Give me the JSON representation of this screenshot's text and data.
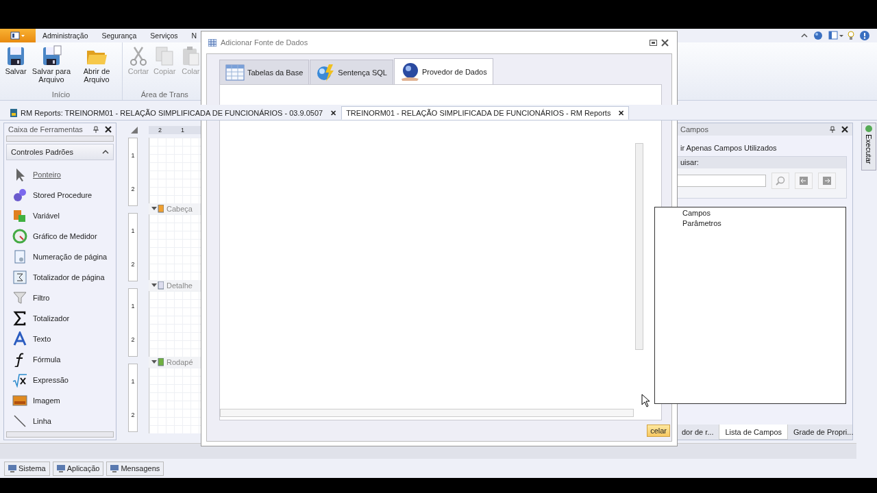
{
  "ribbon": {
    "tabs": [
      {
        "label": "Administração"
      },
      {
        "label": "Segurança"
      },
      {
        "label": "Serviços"
      },
      {
        "label": "N"
      }
    ],
    "groups": [
      {
        "label": "Início",
        "buttons": [
          {
            "label": "Salvar",
            "kind": "save",
            "disabled": false
          },
          {
            "label": "Salvar para Arquivo",
            "kind": "save-as",
            "disabled": false
          },
          {
            "label": "Abrir de Arquivo",
            "kind": "open",
            "disabled": false
          }
        ]
      },
      {
        "label": "Área de Trans",
        "buttons": [
          {
            "label": "Cortar",
            "kind": "cut",
            "disabled": true
          },
          {
            "label": "Copiar",
            "kind": "copy",
            "disabled": true
          },
          {
            "label": "Colar",
            "kind": "paste",
            "disabled": true
          }
        ]
      }
    ]
  },
  "doc_tabs": [
    {
      "label": "RM Reports: TREINORM01 - RELAÇÃO SIMPLIFICADA DE FUNCIONÁRIOS - 03.9.0507",
      "close": "✕",
      "selected": false
    },
    {
      "label": "TREINORM01 - RELAÇÃO SIMPLIFICADA DE FUNCIONÁRIOS - RM Reports",
      "close": "✕",
      "selected": true
    }
  ],
  "toolbox": {
    "title": "Caixa de Ferramentas",
    "section": "Controles Padrões",
    "expanded": true,
    "items": [
      {
        "label": "Ponteiro",
        "kind": "pointer",
        "selected": true
      },
      {
        "label": "Stored Procedure",
        "kind": "procedure",
        "selected": false
      },
      {
        "label": "Variável",
        "kind": "variable",
        "selected": false
      },
      {
        "label": "Gráfico de Medidor",
        "kind": "gauge",
        "selected": false
      },
      {
        "label": "Numeração de página",
        "kind": "page-number",
        "selected": false
      },
      {
        "label": "Totalizador de página",
        "kind": "page-total",
        "selected": false
      },
      {
        "label": "Filtro",
        "kind": "filter",
        "selected": false
      },
      {
        "label": "Totalizador",
        "kind": "sum",
        "selected": false
      },
      {
        "label": "Texto",
        "kind": "text",
        "selected": false
      },
      {
        "label": "Fórmula",
        "kind": "formula",
        "selected": false
      },
      {
        "label": "Expressão",
        "kind": "expression",
        "selected": false
      },
      {
        "label": "Imagem",
        "kind": "image",
        "selected": false
      },
      {
        "label": "Linha",
        "kind": "line",
        "selected": false
      }
    ]
  },
  "designer": {
    "ruler": [
      "2",
      "1"
    ],
    "bands": [
      {
        "label": "Cabeça",
        "kind": "header"
      },
      {
        "label": "Detalhe",
        "kind": "detail"
      },
      {
        "label": "Rodapé",
        "kind": "footer"
      }
    ],
    "side_ruler": [
      {
        "marks": [
          "1",
          "2"
        ]
      },
      {
        "marks": [
          "1",
          "2"
        ]
      },
      {
        "marks": [
          "1",
          "2"
        ]
      },
      {
        "marks": [
          "1",
          "2"
        ]
      }
    ]
  },
  "dialog": {
    "title": "Adicionar Fonte de Dados",
    "tabs": [
      {
        "label": "Tabelas da Base",
        "kind": "tables",
        "selected": false
      },
      {
        "label": "Sentença SQL",
        "kind": "sql",
        "selected": false
      },
      {
        "label": "Provedor de Dados",
        "kind": "provider",
        "selected": true
      }
    ],
    "button": "celar"
  },
  "fields_panel": {
    "title": "Campos",
    "option": "ir Apenas Campos Utilizados",
    "search_label": "uisar:",
    "tree": [
      {
        "label": "Campos"
      },
      {
        "label": "Parâmetros"
      }
    ],
    "bottom_tabs": [
      {
        "label": "dor de r...",
        "selected": false
      },
      {
        "label": "Lista de Campos",
        "selected": true
      },
      {
        "label": "Grade de Propri...",
        "selected": false
      }
    ]
  },
  "side_tab": "Executar",
  "status_tabs": [
    {
      "label": "Sistema"
    },
    {
      "label": "Aplicação"
    },
    {
      "label": "Mensagens"
    }
  ]
}
